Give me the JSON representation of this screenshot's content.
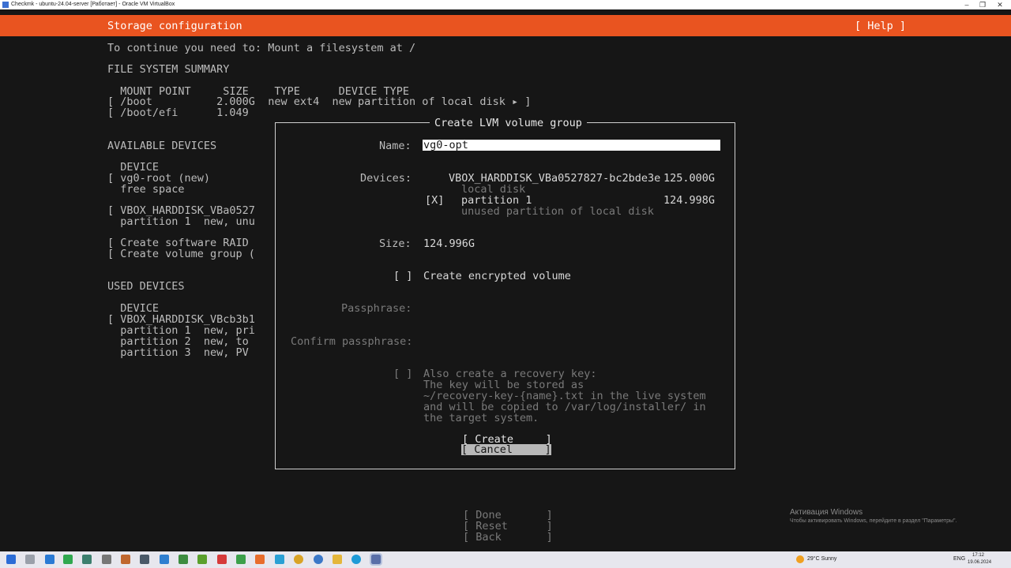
{
  "window": {
    "title": "Checkmk - ubuntu-24.04-server [Работает] - Oracle VM VirtualBox",
    "controls": [
      "–",
      "❐",
      "✕"
    ]
  },
  "header": {
    "title": "Storage configuration",
    "help_label": "[ Help ]",
    "color": "#e95420"
  },
  "background": {
    "instruction": "To continue you need to: Mount a filesystem at /",
    "fs_summary_title": "FILE SYSTEM SUMMARY",
    "fs_header": "  MOUNT POINT     SIZE    TYPE      DEVICE TYPE",
    "fs_rows": [
      "[ /boot          2.000G  new ext4  new partition of local disk ▸ ]",
      "[ /boot/efi      1.049"
    ],
    "available_title": "AVAILABLE DEVICES",
    "available_lines": [
      "  DEVICE",
      "[ vg0-root (new)",
      "  free space",
      "",
      "[ VBOX_HARDDISK_VBa0527",
      "  partition 1  new, unu",
      "",
      "[ Create software RAID",
      "[ Create volume group ("
    ],
    "used_title": "USED DEVICES",
    "used_lines": [
      "  DEVICE",
      "[ VBOX_HARDDISK_VBcb3b1",
      "  partition 1  new, pri",
      "  partition 2  new, to",
      "  partition 3  new, PV"
    ],
    "bottom_buttons": [
      "[ Done       ]",
      "[ Reset      ]",
      "[ Back       ]"
    ]
  },
  "dialog": {
    "title": "Create LVM volume group",
    "name_label": "Name:",
    "name_value": "vg0-opt",
    "devices_label": "Devices:",
    "disk_name": "VBOX_HARDDISK_VBa0527827-bc2bde3e",
    "disk_size": "125.000G",
    "disk_desc": "local disk",
    "partition_check": "[X]",
    "partition_name": "partition 1",
    "partition_size": "124.998G",
    "partition_desc": "unused partition of local disk",
    "size_label": "Size:",
    "size_value": "124.996G",
    "encrypt_check": "[ ]",
    "encrypt_label": "Create encrypted volume",
    "passphrase_label": "Passphrase:",
    "confirm_label": "Confirm passphrase:",
    "recovery_check": "[ ]",
    "recovery_lines": [
      "Also create a recovery key:",
      "The key will be stored as",
      "~/recovery-key-{name}.txt in the live system",
      "and will be copied to /var/log/installer/ in",
      "the target system."
    ],
    "create_label": "[ Create     ]",
    "cancel_label": "[ Cancel     ]"
  },
  "windows_activation": {
    "title": "Активация Windows",
    "subtitle": "Чтобы активировать Windows, перейдите в раздел \"Параметры\"."
  },
  "taskbar": {
    "weather": "29°C  Sunny",
    "lang": "ENG",
    "time": "17:12",
    "date": "19.06.2024"
  }
}
